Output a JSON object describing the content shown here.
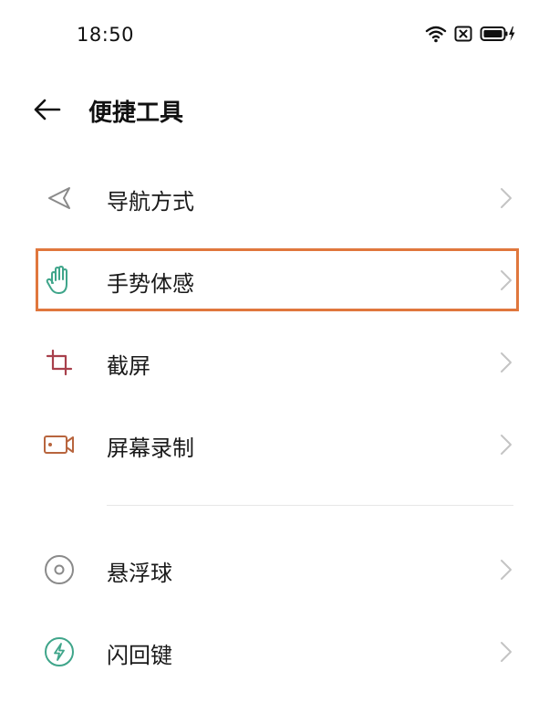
{
  "status_bar": {
    "time": "18:50",
    "icons": [
      "wifi-icon",
      "sim-blocked-icon",
      "battery-charging-icon"
    ]
  },
  "header": {
    "title": "便捷工具",
    "back_icon": "back-arrow-icon"
  },
  "menu": {
    "items": [
      {
        "label": "导航方式",
        "icon": "navigation-icon",
        "color": "#8a8a8a"
      },
      {
        "label": "手势体感",
        "icon": "hand-gesture-icon",
        "color": "#3fa58a",
        "highlighted": true
      },
      {
        "label": "截屏",
        "icon": "crop-icon",
        "color": "#a8404c"
      },
      {
        "label": "屏幕录制",
        "icon": "video-camera-icon",
        "color": "#b8653e"
      },
      {
        "label": "悬浮球",
        "icon": "floating-ball-icon",
        "color": "#8a8a8a"
      },
      {
        "label": "闪回键",
        "icon": "flash-button-icon",
        "color": "#3fa58a"
      }
    ]
  },
  "colors": {
    "highlight": "#e0773d",
    "chevron": "#c4c4c4",
    "divider": "#e6e6e6"
  }
}
